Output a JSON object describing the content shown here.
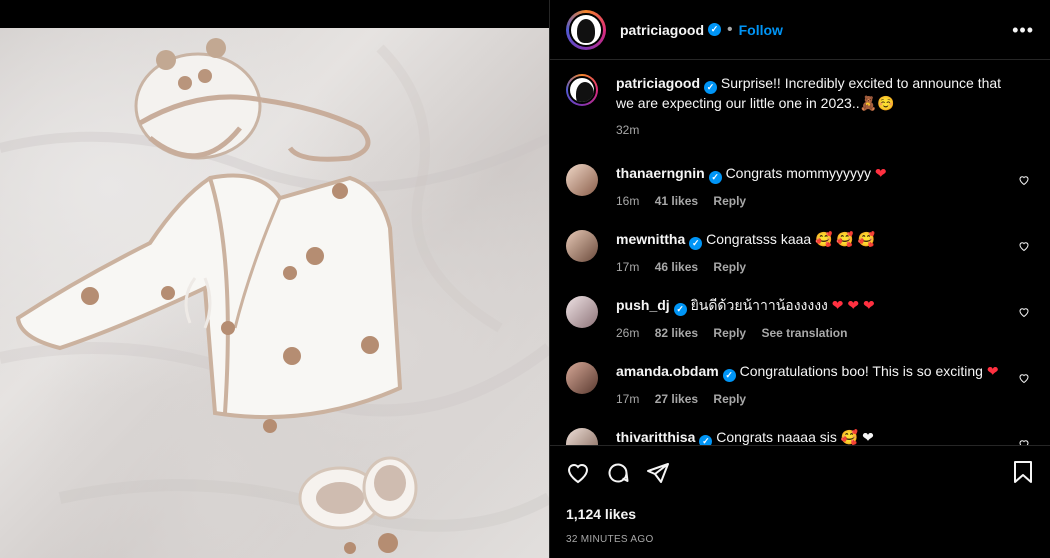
{
  "post": {
    "author": "patriciagood",
    "follow_label": "Follow",
    "more_label": "•••",
    "caption": "Surprise!! Incredibly excited to announce that we are expecting our little one in 2023..🧸☺️",
    "caption_time": "32m",
    "likes": "1,124 likes",
    "posted_ago": "32 MINUTES AGO"
  },
  "comments": [
    {
      "user": "thanaerngnin",
      "text": "Congrats mommyyyyyy",
      "emoji": "❤",
      "time": "16m",
      "likes": "41 likes",
      "reply": "Reply",
      "extra": "",
      "avatar_color": "#d9b8a8"
    },
    {
      "user": "mewnittha",
      "text": "Congratsss kaaa",
      "emoji": "🥰 🥰 🥰",
      "time": "17m",
      "likes": "46 likes",
      "reply": "Reply",
      "extra": "",
      "avatar_color": "#b58a74"
    },
    {
      "user": "push_dj",
      "text": "ยินดีด้วยน้าาาน้องงงงง",
      "emoji": "❤ ❤ ❤",
      "time": "26m",
      "likes": "82 likes",
      "reply": "Reply",
      "extra": "See translation",
      "avatar_color": "#c9b2b4"
    },
    {
      "user": "amanda.obdam",
      "text": "Congratulations boo! This is so exciting",
      "emoji": "❤",
      "time": "17m",
      "likes": "27 likes",
      "reply": "Reply",
      "extra": "",
      "avatar_color": "#a7746a"
    },
    {
      "user": "thivaritthisa",
      "text": "Congrats naaaa sis",
      "emoji": "🥰 ❤",
      "time": "",
      "likes": "",
      "reply": "",
      "extra": "",
      "avatar_color": "#c2a89c"
    }
  ],
  "colors": {
    "accent": "#0095f6",
    "heart": "#ff3040",
    "muted": "#a8a8a8"
  }
}
